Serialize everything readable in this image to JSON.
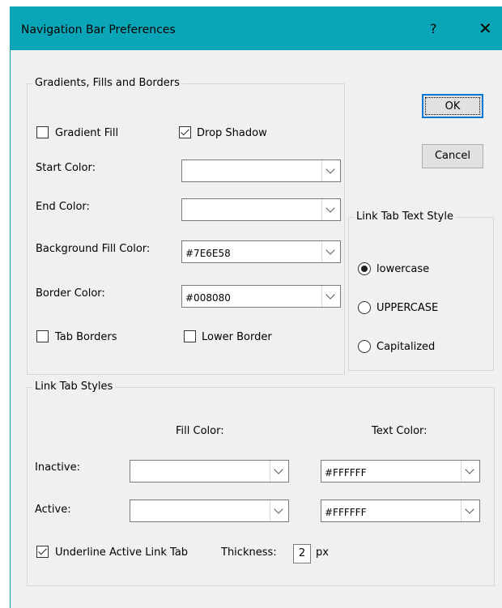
{
  "window": {
    "title": "Navigation Bar Preferences",
    "help_glyph": "?",
    "close_glyph": "✕"
  },
  "buttons": {
    "ok": "OK",
    "cancel": "Cancel"
  },
  "gradients": {
    "legend": "Gradients, Fills and Borders",
    "gradient_fill": {
      "label": "Gradient Fill",
      "checked": false
    },
    "drop_shadow": {
      "label": "Drop Shadow",
      "checked": true
    },
    "start_color": {
      "label": "Start Color:",
      "value": ""
    },
    "end_color": {
      "label": "End Color:",
      "value": ""
    },
    "background_fill": {
      "label": "Background Fill Color:",
      "value": "#7E6E58"
    },
    "border_color": {
      "label": "Border Color:",
      "value": "#008080"
    },
    "tab_borders": {
      "label": "Tab Borders",
      "checked": false
    },
    "lower_border": {
      "label": "Lower Border",
      "checked": false
    }
  },
  "text_style": {
    "legend": "Link Tab Text Style",
    "options": [
      {
        "label": "lowercase",
        "selected": true
      },
      {
        "label": "UPPERCASE",
        "selected": false
      },
      {
        "label": "Capitalized",
        "selected": false
      }
    ]
  },
  "link_tab_styles": {
    "legend": "Link Tab Styles",
    "fill_header": "Fill Color:",
    "text_header": "Text Color:",
    "inactive": {
      "label": "Inactive:",
      "fill": "",
      "text": "#FFFFFF"
    },
    "active": {
      "label": "Active:",
      "fill": "",
      "text": "#FFFFFF"
    },
    "underline": {
      "label": "Underline Active Link Tab",
      "checked": true
    },
    "thickness_label": "Thickness:",
    "thickness_value": "2",
    "thickness_unit": "px"
  },
  "colors": {
    "titlebar": "#0aa6b8",
    "dialog_bg": "#f0f0f0",
    "default_button_border": "#0078d7"
  }
}
